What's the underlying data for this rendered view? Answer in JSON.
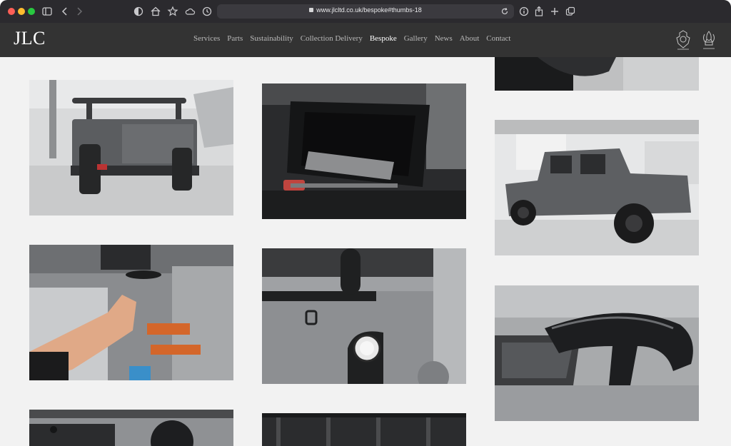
{
  "browser": {
    "url": "www.jlcltd.co.uk/bespoke#thumbs-18"
  },
  "site": {
    "logo": "JLC",
    "nav": [
      {
        "label": "Services",
        "active": false
      },
      {
        "label": "Parts",
        "active": false
      },
      {
        "label": "Sustainability",
        "active": false
      },
      {
        "label": "Collection Delivery",
        "active": false
      },
      {
        "label": "Bespoke",
        "active": true
      },
      {
        "label": "Gallery",
        "active": false
      },
      {
        "label": "News",
        "active": false
      },
      {
        "label": "About",
        "active": false
      },
      {
        "label": "Contact",
        "active": false
      }
    ],
    "crests": [
      "royal-warrant-crest-1",
      "royal-warrant-crest-2"
    ]
  },
  "gallery": {
    "thumbs": [
      {
        "name": "thumb-defender-rear-rollcage"
      },
      {
        "name": "thumb-storage-tray"
      },
      {
        "name": "thumb-top-partial"
      },
      {
        "name": "thumb-defender-pickup-side"
      },
      {
        "name": "thumb-hand-fitting-part"
      },
      {
        "name": "thumb-rear-light-detail"
      },
      {
        "name": "thumb-snorkel-vent-detail"
      },
      {
        "name": "thumb-bottom-left-partial"
      },
      {
        "name": "thumb-bottom-mid-partial"
      }
    ]
  }
}
